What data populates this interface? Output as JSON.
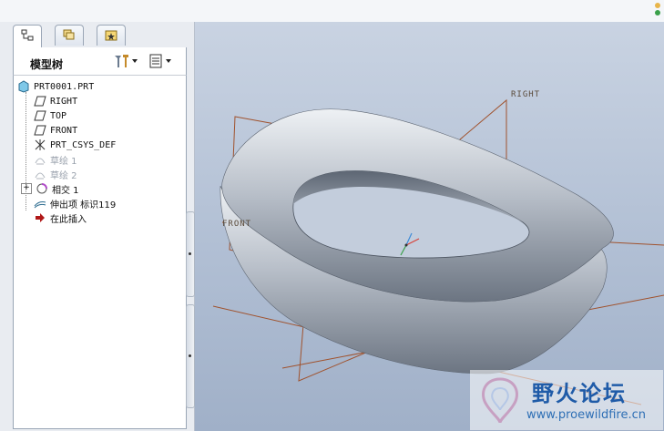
{
  "panel": {
    "title": "模型树",
    "tabs": [
      {
        "icon": "model-tree-icon"
      },
      {
        "icon": "layers-icon"
      },
      {
        "icon": "favorites-folder-icon"
      }
    ]
  },
  "tree": {
    "items": [
      {
        "label": "PRT0001.PRT",
        "icon": "part-icon"
      },
      {
        "label": "RIGHT",
        "icon": "datum-plane-icon"
      },
      {
        "label": "TOP",
        "icon": "datum-plane-icon"
      },
      {
        "label": "FRONT",
        "icon": "datum-plane-icon"
      },
      {
        "label": "PRT_CSYS_DEF",
        "icon": "coordinate-system-icon"
      },
      {
        "label": "草绘 1",
        "icon": "sketch-icon"
      },
      {
        "label": "草绘 2",
        "icon": "sketch-icon"
      },
      {
        "label": "相交 1",
        "icon": "intersect-icon"
      },
      {
        "label": "伸出项 标识119",
        "icon": "protrusion-icon"
      },
      {
        "label": "在此插入",
        "icon": "insert-here-arrow-icon"
      }
    ]
  },
  "viewport": {
    "labels": {
      "right": "RIGHT",
      "front": "FRONT"
    }
  },
  "watermark": {
    "title": "野火论坛",
    "url": "www.proewildfire.cn"
  },
  "colors": {
    "brand_blue": "#1f5ba8",
    "datum_plane": "#a0522d",
    "background_top": "#c9d3e2",
    "background_bottom": "#a0b0c8"
  }
}
